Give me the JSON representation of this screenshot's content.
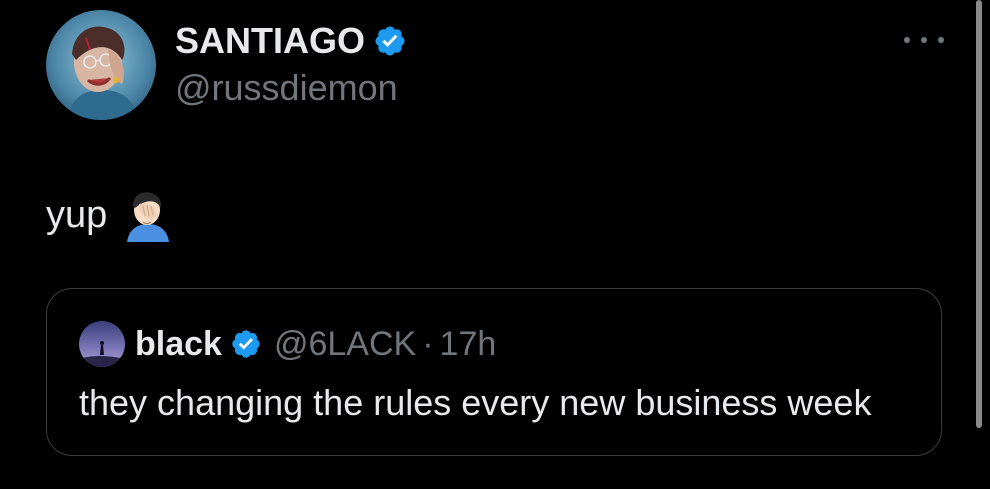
{
  "tweet": {
    "author": {
      "display_name": "SANTIAGO",
      "handle": "@russdiemon",
      "verified": true,
      "avatar_icon": "profile-portrait-avatar"
    },
    "more_icon": "more-horizontal-icon",
    "text": "yup",
    "emoji": "man-facepalming-emoji"
  },
  "quoted_tweet": {
    "author": {
      "display_name": "black",
      "handle": "@6LACK",
      "verified": true,
      "avatar_icon": "night-sky-avatar"
    },
    "separator": "·",
    "time": "17h",
    "text": "they changing the rules every new business week"
  },
  "colors": {
    "background": "#000000",
    "primary_text": "#e7e9ea",
    "secondary_text": "#71767b",
    "verified_blue": "#1d9bf0",
    "quote_border": "#3a3d40"
  }
}
